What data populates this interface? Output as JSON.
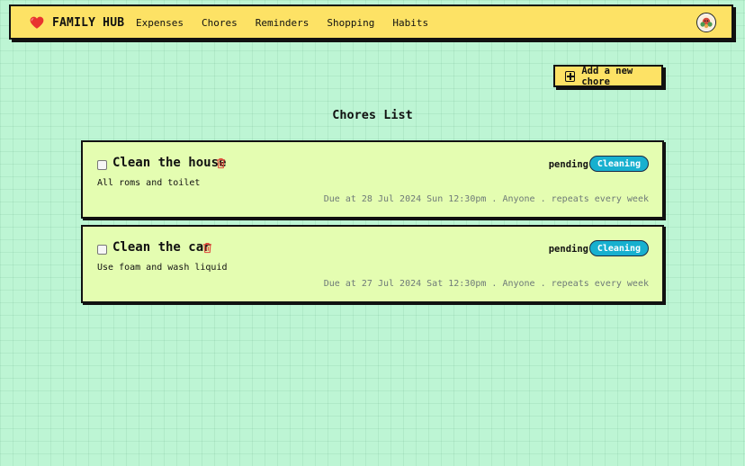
{
  "header": {
    "brand": "FAMILY HUB",
    "nav": [
      "Expenses",
      "Chores",
      "Reminders",
      "Shopping",
      "Habits"
    ]
  },
  "icons": {
    "brand": "heart-icon",
    "add": "plus-square-icon",
    "delete": "trash-icon",
    "user": "avatar"
  },
  "colors": {
    "navbar": "#fde265",
    "background": "#bdf5d4",
    "card": "#e4fdb1",
    "tag": "#17b0cf",
    "trash": "#e0483a"
  },
  "actions": {
    "add_chore": "Add a new chore"
  },
  "page": {
    "title": "Chores List"
  },
  "chores": [
    {
      "title": "Clean the house",
      "status": "pending",
      "category": "Cleaning",
      "description": "All roms and toilet",
      "meta": "Due at 28 Jul 2024 Sun 12:30pm . Anyone . repeats every week",
      "checked": false
    },
    {
      "title": "Clean the car",
      "status": "pending",
      "category": "Cleaning",
      "description": "Use foam and wash liquid",
      "meta": "Due at 27 Jul 2024 Sat 12:30pm . Anyone . repeats every week",
      "checked": false
    }
  ]
}
